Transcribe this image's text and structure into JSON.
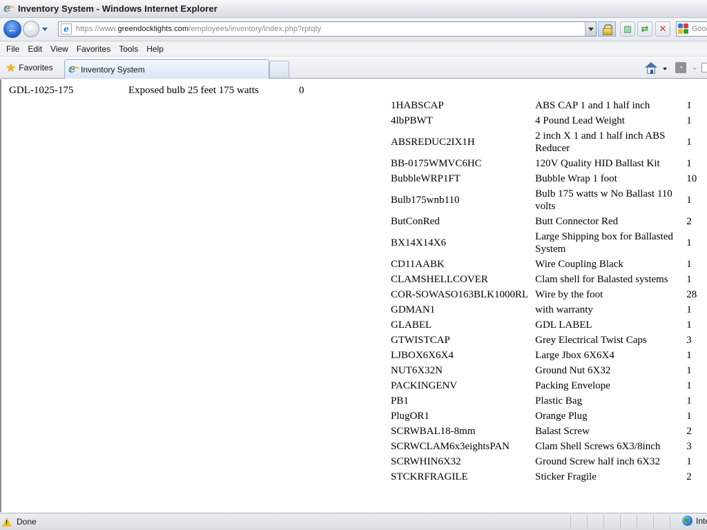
{
  "window": {
    "title": "Inventory System - Windows Internet Explorer"
  },
  "addressbar": {
    "url_prefix": "https://www.",
    "url_domain": "greendocklights.com",
    "url_path": "/employees/inventory/index.php?rptqty",
    "search_placeholder": "Google"
  },
  "menubar": {
    "items": [
      "File",
      "Edit",
      "View",
      "Favorites",
      "Tools",
      "Help"
    ]
  },
  "favbar": {
    "favorites_label": "Favorites",
    "tab_label": "Inventory System"
  },
  "content": {
    "top_row": {
      "code": "GDL-1025-175",
      "description": "Exposed bulb 25 feet 175 watts",
      "qty": "0"
    },
    "items": [
      {
        "code": "1HABSCAP",
        "description": "ABS CAP 1 and 1 half inch",
        "qty": "1"
      },
      {
        "code": "4lbPBWT",
        "description": "4 Pound Lead Weight",
        "qty": "1"
      },
      {
        "code": "ABSREDUC2IX1H",
        "description": "2 inch X 1 and 1 half inch ABS Reducer",
        "qty": "1"
      },
      {
        "code": "BB-0175WMVC6HC",
        "description": "120V Quality HID Ballast Kit",
        "qty": "1"
      },
      {
        "code": "BubbleWRP1FT",
        "description": "Bubble Wrap 1 foot",
        "qty": "10"
      },
      {
        "code": "Bulb175wnb110",
        "description": "Bulb 175 watts w No Ballast 110 volts",
        "qty": "1"
      },
      {
        "code": "ButConRed",
        "description": "Butt Connector Red",
        "qty": "2"
      },
      {
        "code": "BX14X14X6",
        "description": "Large Shipping box for Ballasted System",
        "qty": "1"
      },
      {
        "code": "CD11AABK",
        "description": "Wire Coupling Black",
        "qty": "1"
      },
      {
        "code": "CLAMSHELLCOVER",
        "description": "Clam shell for Balasted systems",
        "qty": "1"
      },
      {
        "code": "COR-SOWASO163BLK1000RL",
        "description": "Wire by the foot",
        "qty": "28"
      },
      {
        "code": "GDMAN1",
        "description": "with warranty",
        "qty": "1"
      },
      {
        "code": "GLABEL",
        "description": "GDL LABEL",
        "qty": "1"
      },
      {
        "code": "GTWISTCAP",
        "description": "Grey Electrical Twist Caps",
        "qty": "3"
      },
      {
        "code": "LJBOX6X6X4",
        "description": "Large Jbox 6X6X4",
        "qty": "1"
      },
      {
        "code": "NUT6X32N",
        "description": "Ground Nut 6X32",
        "qty": "1"
      },
      {
        "code": "PACKINGENV",
        "description": "Packing Envelope",
        "qty": "1"
      },
      {
        "code": "PB1",
        "description": "Plastic Bag",
        "qty": "1"
      },
      {
        "code": "PlugOR1",
        "description": "Orange Plug",
        "qty": "1"
      },
      {
        "code": "SCRWBAL18-8mm",
        "description": "Balast Screw",
        "qty": "2"
      },
      {
        "code": "SCRWCLAM6x3eightsPAN",
        "description": "Clam Shell Screws 6X3/8inch",
        "qty": "3"
      },
      {
        "code": "SCRWHIN6X32",
        "description": "Ground Screw half inch 6X32",
        "qty": "1"
      },
      {
        "code": "STCKRFRAGILE",
        "description": "Sticker Fragile",
        "qty": "2"
      }
    ]
  },
  "statusbar": {
    "status": "Done",
    "zone": "Internet"
  },
  "icons": {
    "ie": "ie-logo-icon",
    "back": "back-arrow-icon",
    "forward": "forward-arrow-icon",
    "lock": "lock-icon",
    "compat": "compatibility-view-icon",
    "refresh": "refresh-icon",
    "stop": "stop-icon",
    "search_provider": "google-icon",
    "favorites": "star-icon",
    "home": "home-icon",
    "feeds": "rss-feed-icon",
    "warning": "warning-icon",
    "zone": "globe-icon"
  }
}
